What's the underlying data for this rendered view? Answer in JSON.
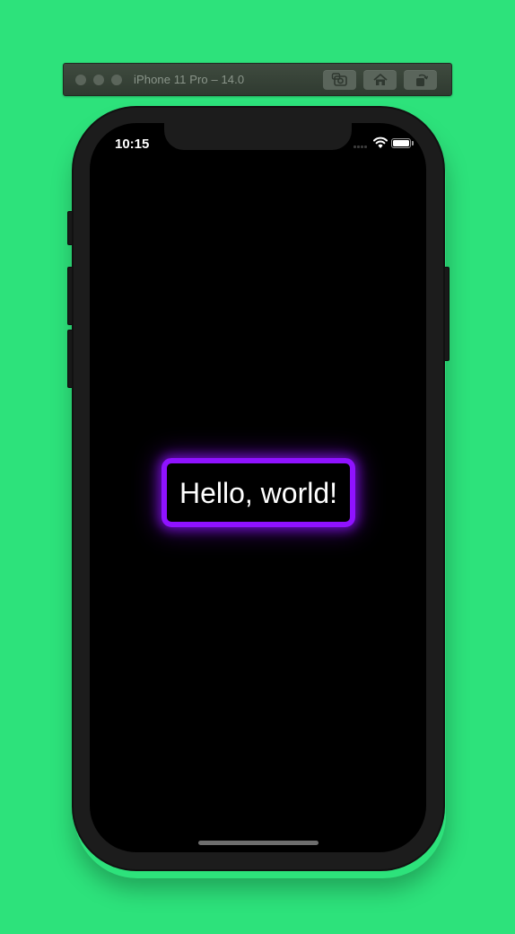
{
  "simulator": {
    "title": "iPhone 11 Pro – 14.0",
    "buttons": {
      "screenshot": "camera-icon",
      "home": "home-icon",
      "rotate": "rotate-icon"
    }
  },
  "status_bar": {
    "time": "10:15",
    "icons": [
      "signal-icon",
      "wifi-icon",
      "battery-icon"
    ]
  },
  "content": {
    "label": "Hello, world!",
    "border_color": "#8f12ff"
  },
  "colors": {
    "background": "#2de27b",
    "screen": "#000000",
    "bezel": "#1c1c1c",
    "text": "#ffffff"
  }
}
